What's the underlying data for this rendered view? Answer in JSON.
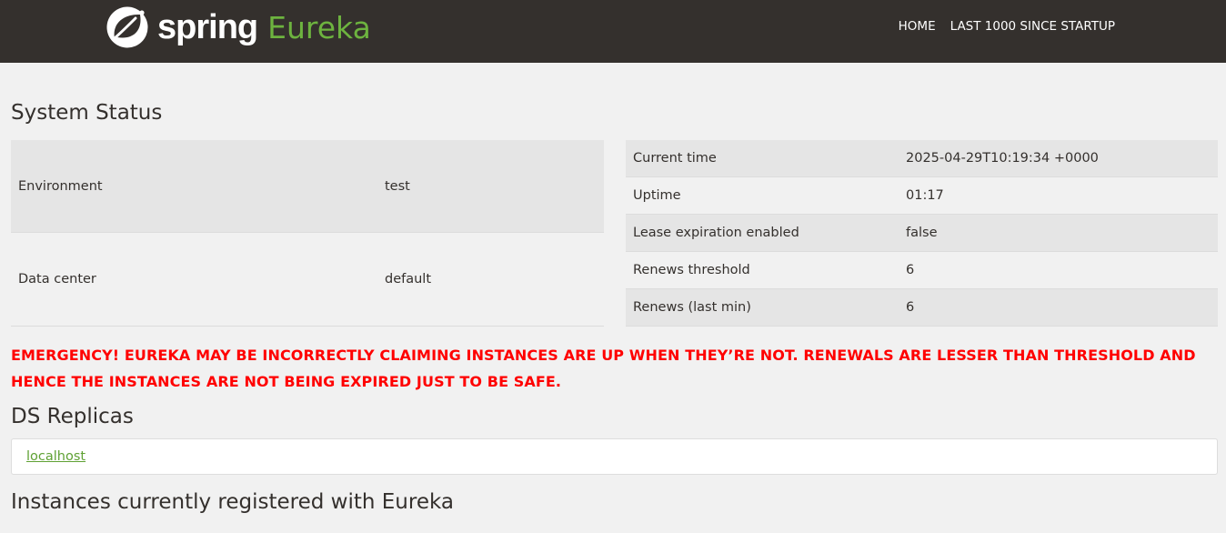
{
  "header": {
    "brand_spring": "spring",
    "brand_eureka": "Eureka",
    "nav": [
      "HOME",
      "LAST 1000 SINCE STARTUP"
    ]
  },
  "system_status": {
    "title": "System Status",
    "left_rows": [
      {
        "key": "Environment",
        "value": "test"
      },
      {
        "key": "Data center",
        "value": "default"
      }
    ],
    "right_rows": [
      {
        "key": "Current time",
        "value": "2025-04-29T10:19:34 +0000"
      },
      {
        "key": "Uptime",
        "value": "01:17"
      },
      {
        "key": "Lease expiration enabled",
        "value": "false"
      },
      {
        "key": "Renews threshold",
        "value": "6"
      },
      {
        "key": "Renews (last min)",
        "value": "6"
      }
    ]
  },
  "emergency_message": "EMERGENCY! EUREKA MAY BE INCORRECTLY CLAIMING INSTANCES ARE UP WHEN THEY’RE NOT. RENEWALS ARE LESSER THAN THRESHOLD AND HENCE THE INSTANCES ARE NOT BEING EXPIRED JUST TO BE SAFE.",
  "ds_replicas": {
    "title": "DS Replicas",
    "items": [
      "localhost"
    ]
  },
  "instances": {
    "title": "Instances currently registered with Eureka"
  },
  "colors": {
    "navbar": "#34302d",
    "brand_green": "#6db33f",
    "emergency_red": "#ff0000",
    "link_green": "#5fa134"
  }
}
